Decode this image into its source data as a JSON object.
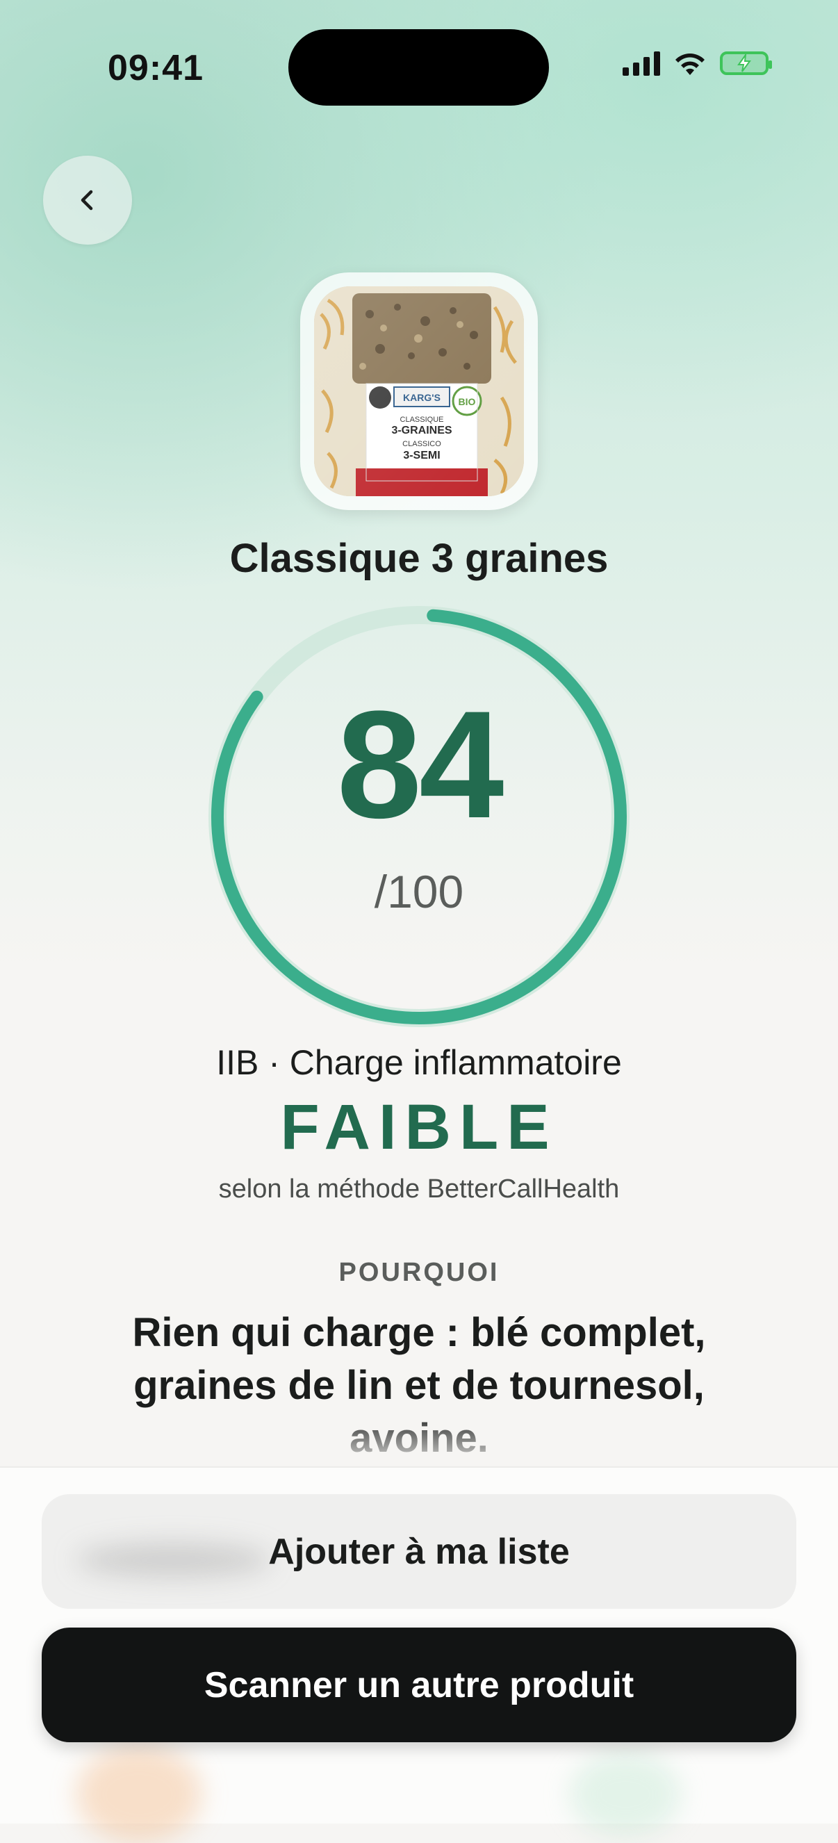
{
  "status_bar": {
    "time": "09:41"
  },
  "product": {
    "name": "Classique 3 graines",
    "image_alt": "Karg's Classique 3-Graines crackers package"
  },
  "score": {
    "value": "84",
    "max_label": "/100",
    "progress_fraction": 0.84
  },
  "rating": {
    "label": "IIB · Charge inflammatoire",
    "level": "FAIBLE",
    "method": "selon la méthode BetterCallHealth"
  },
  "why": {
    "label": "POURQUOI",
    "text": "Rien qui charge : blé complet, graines de lin et de tournesol, avoine."
  },
  "actions": {
    "add_to_list": "Ajouter à ma liste",
    "scan_another": "Scanner un autre produit"
  },
  "icons": {
    "back": "chevron-left-icon"
  },
  "colors": {
    "accent": "#226b4f",
    "gauge": "#3bae8c"
  }
}
